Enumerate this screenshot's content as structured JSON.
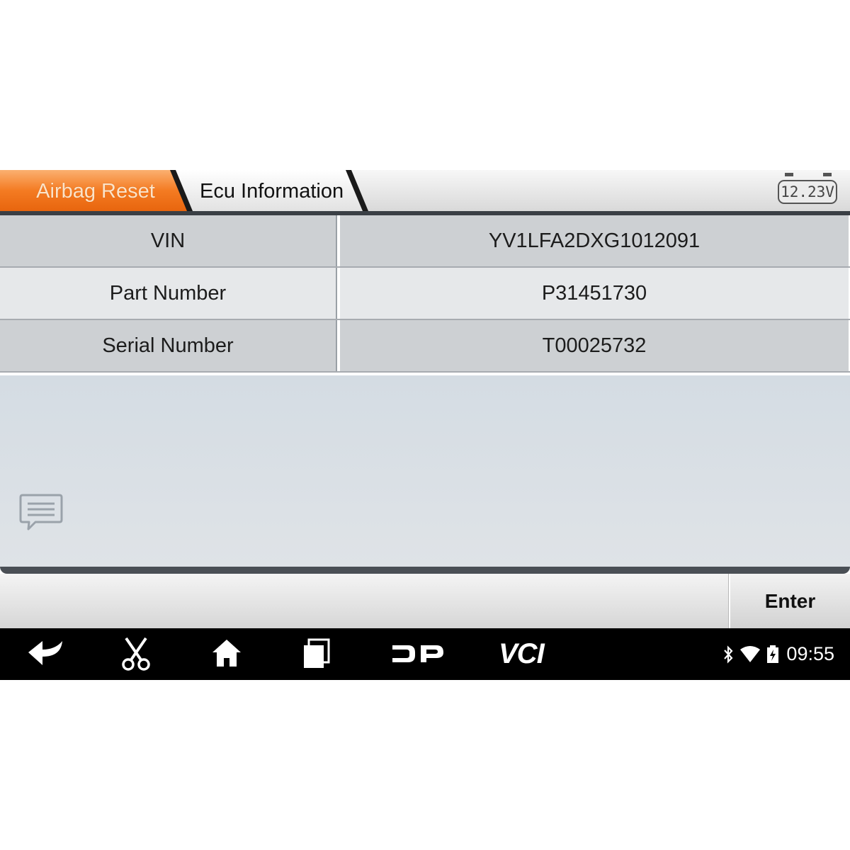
{
  "tabs": {
    "active": "Airbag Reset",
    "second": "Ecu Information"
  },
  "battery_voltage": "12.23V",
  "table": {
    "rows": [
      {
        "label": "VIN",
        "value": "YV1LFA2DXG1012091"
      },
      {
        "label": "Part Number",
        "value": "P31451730"
      },
      {
        "label": "Serial Number",
        "value": "T00025732"
      }
    ]
  },
  "actions": {
    "enter_label": "Enter"
  },
  "navbar": {
    "items": [
      "back-icon",
      "scissors-icon",
      "home-icon",
      "recent-apps-icon",
      "dp-icon"
    ],
    "vci_label": "VCI",
    "status_icons": [
      "bluetooth-icon",
      "wifi-icon",
      "battery-icon"
    ],
    "clock": "09:55"
  },
  "colors": {
    "accent_orange": "#f07820",
    "navbar_bg": "#000000"
  }
}
